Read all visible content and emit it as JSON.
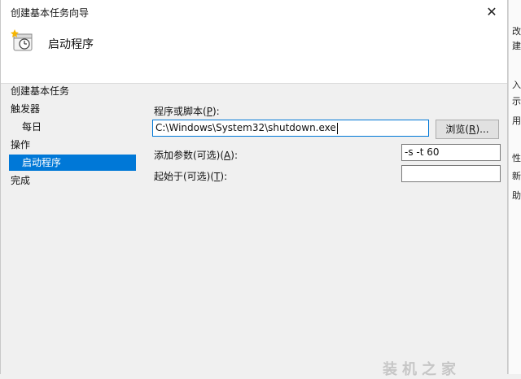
{
  "window": {
    "title": "创建基本任务向导",
    "close_glyph": "✕"
  },
  "header": {
    "heading": "启动程序",
    "icon": "scheduled-task-icon"
  },
  "sidebar": {
    "items": [
      {
        "label": "创建基本任务"
      },
      {
        "label": "触发器"
      },
      {
        "label": "每日"
      },
      {
        "label": "操作"
      },
      {
        "label": "启动程序"
      },
      {
        "label": "完成"
      }
    ]
  },
  "form": {
    "program_label_pre": "程序或脚本(",
    "program_label_key": "P",
    "program_label_post": "):",
    "program_value": "C:\\Windows\\System32\\shutdown.exe",
    "browse_pre": "浏览(",
    "browse_key": "R",
    "browse_post": ")...",
    "args_label_pre": "添加参数(可选)(",
    "args_label_key": "A",
    "args_label_post": "):",
    "args_value": "-s -t 60",
    "start_label_pre": "起始于(可选)(",
    "start_label_key": "T",
    "start_label_post": "):",
    "start_value": ""
  },
  "background_window": {
    "chars": [
      "改",
      "建",
      "入",
      "示",
      "用",
      "性",
      "新",
      "助"
    ]
  },
  "watermark": "装机之家",
  "colors": {
    "selection": "#0078d7",
    "dialog_bg": "#f0f0f0",
    "header_bg": "#ffffff"
  }
}
